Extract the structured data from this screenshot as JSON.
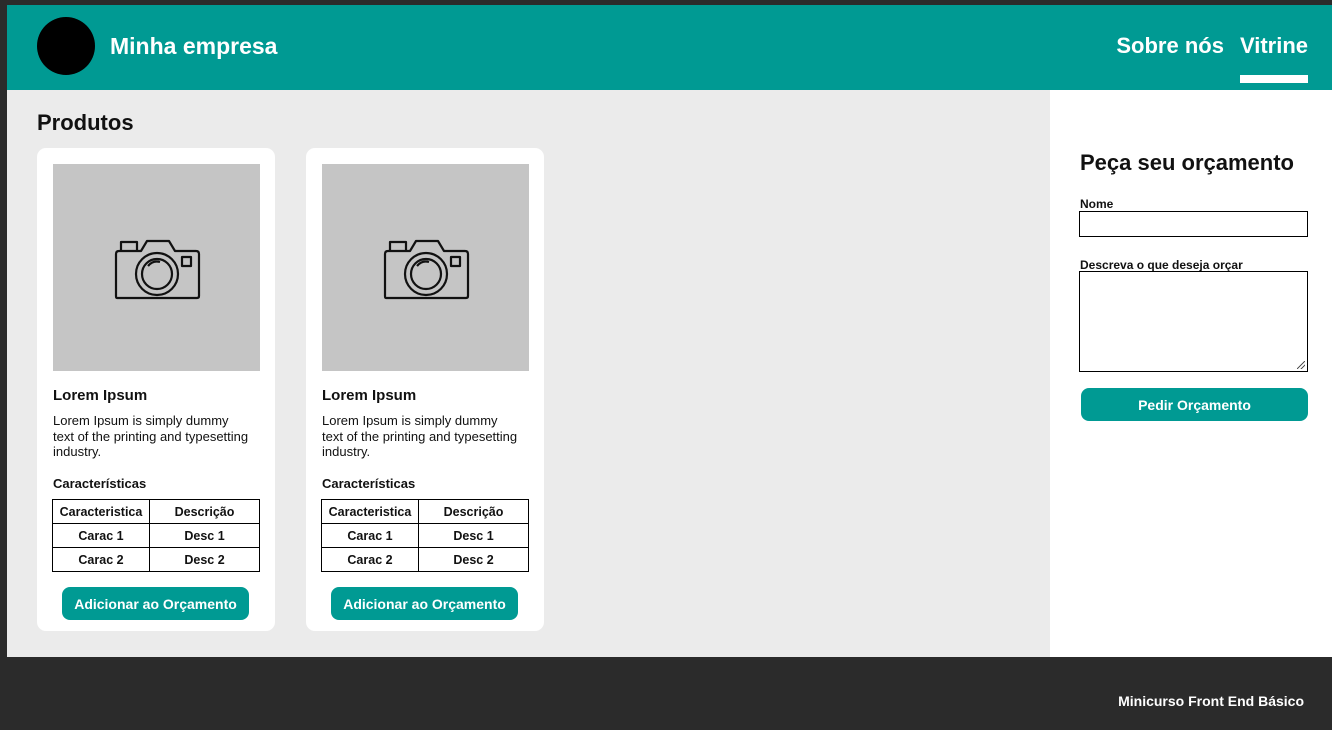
{
  "header": {
    "brand": "Minha empresa",
    "nav": [
      {
        "label": "Sobre nós",
        "active": false
      },
      {
        "label": "Vitrine",
        "active": true
      }
    ]
  },
  "main": {
    "title": "Produtos",
    "products": [
      {
        "image_icon": "camera-icon",
        "name": "Lorem Ipsum",
        "description": "Lorem Ipsum is simply dummy text of the printing and typesetting industry.",
        "features_title": "Características",
        "table": {
          "headers": [
            "Caracteristica",
            "Descrição"
          ],
          "rows": [
            [
              "Carac 1",
              "Desc 1"
            ],
            [
              "Carac 2",
              "Desc 2"
            ]
          ]
        },
        "button_label": "Adicionar ao Orçamento"
      },
      {
        "image_icon": "camera-icon",
        "name": "Lorem Ipsum",
        "description": "Lorem Ipsum is simply dummy text of the printing and typesetting industry.",
        "features_title": "Características",
        "table": {
          "headers": [
            "Caracteristica",
            "Descrição"
          ],
          "rows": [
            [
              "Carac 1",
              "Desc 1"
            ],
            [
              "Carac 2",
              "Desc 2"
            ]
          ]
        },
        "button_label": "Adicionar ao Orçamento"
      }
    ]
  },
  "quote_form": {
    "title": "Peça seu orçamento",
    "name_label": "Nome",
    "name_value": "",
    "description_label": "Descreva o que deseja orçar",
    "description_value": "",
    "submit_label": "Pedir Orçamento"
  },
  "footer": {
    "credit": "Minicurso Front End Básico"
  },
  "colors": {
    "accent": "#009a93",
    "background": "#ebebeb",
    "footer": "#2b2b2b"
  }
}
